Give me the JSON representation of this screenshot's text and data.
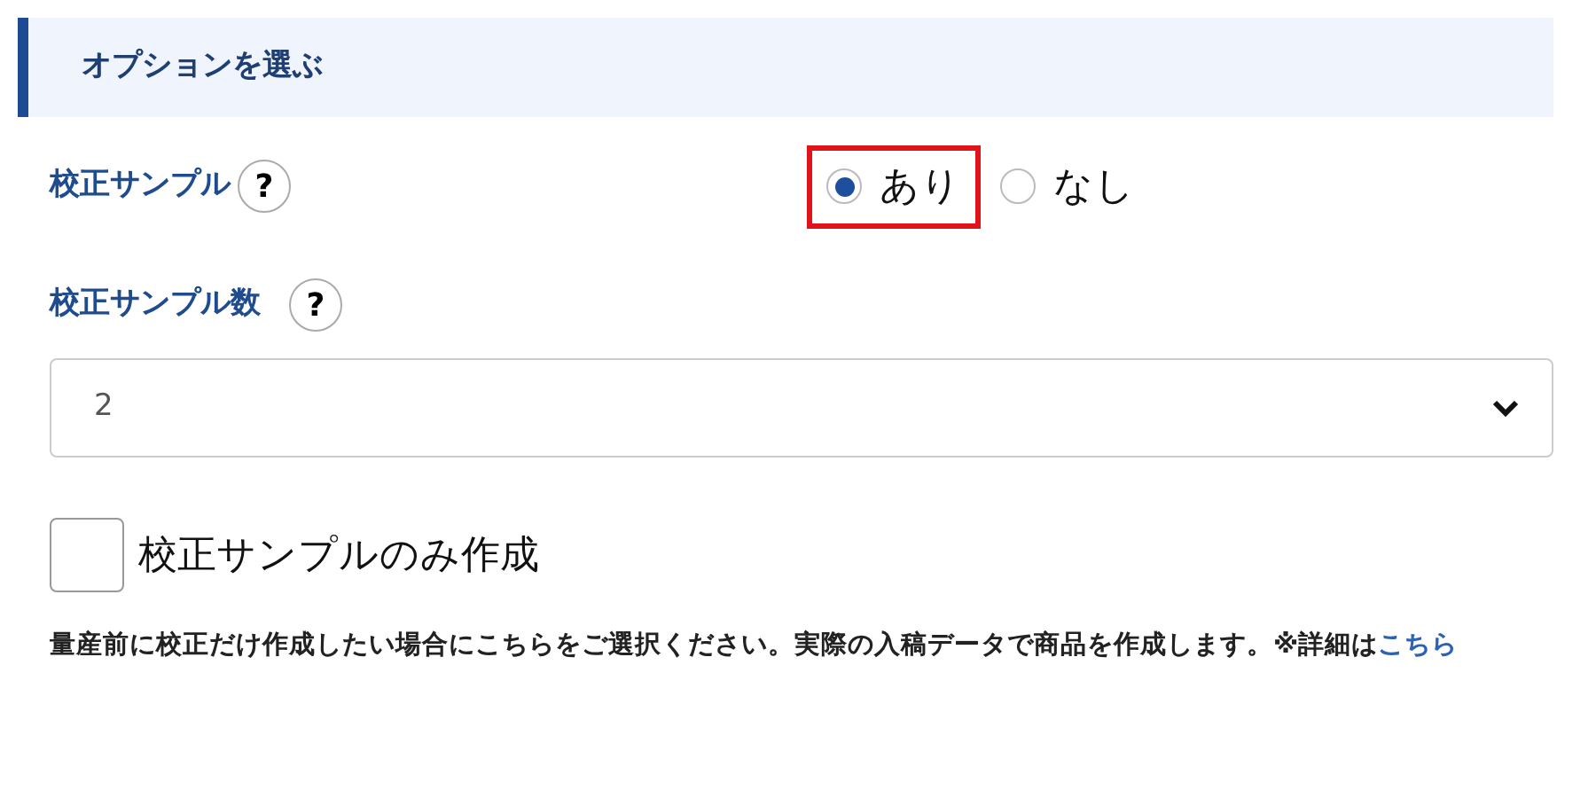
{
  "section_title": "オプションを選ぶ",
  "proof_sample": {
    "label": "校正サンプル",
    "help": "?",
    "options": [
      {
        "label": "あり",
        "selected": true,
        "highlighted": true
      },
      {
        "label": "なし",
        "selected": false,
        "highlighted": false
      }
    ]
  },
  "sample_count": {
    "label": "校正サンプル数",
    "help": "?",
    "value": "2"
  },
  "sample_only": {
    "label": "校正サンプルのみ作成",
    "checked": false
  },
  "description": {
    "text": "量産前に校正だけ作成したい場合にこちらをご選択ください。実際の入稿データで商品を作成します。※詳細は",
    "link": "こちら"
  }
}
